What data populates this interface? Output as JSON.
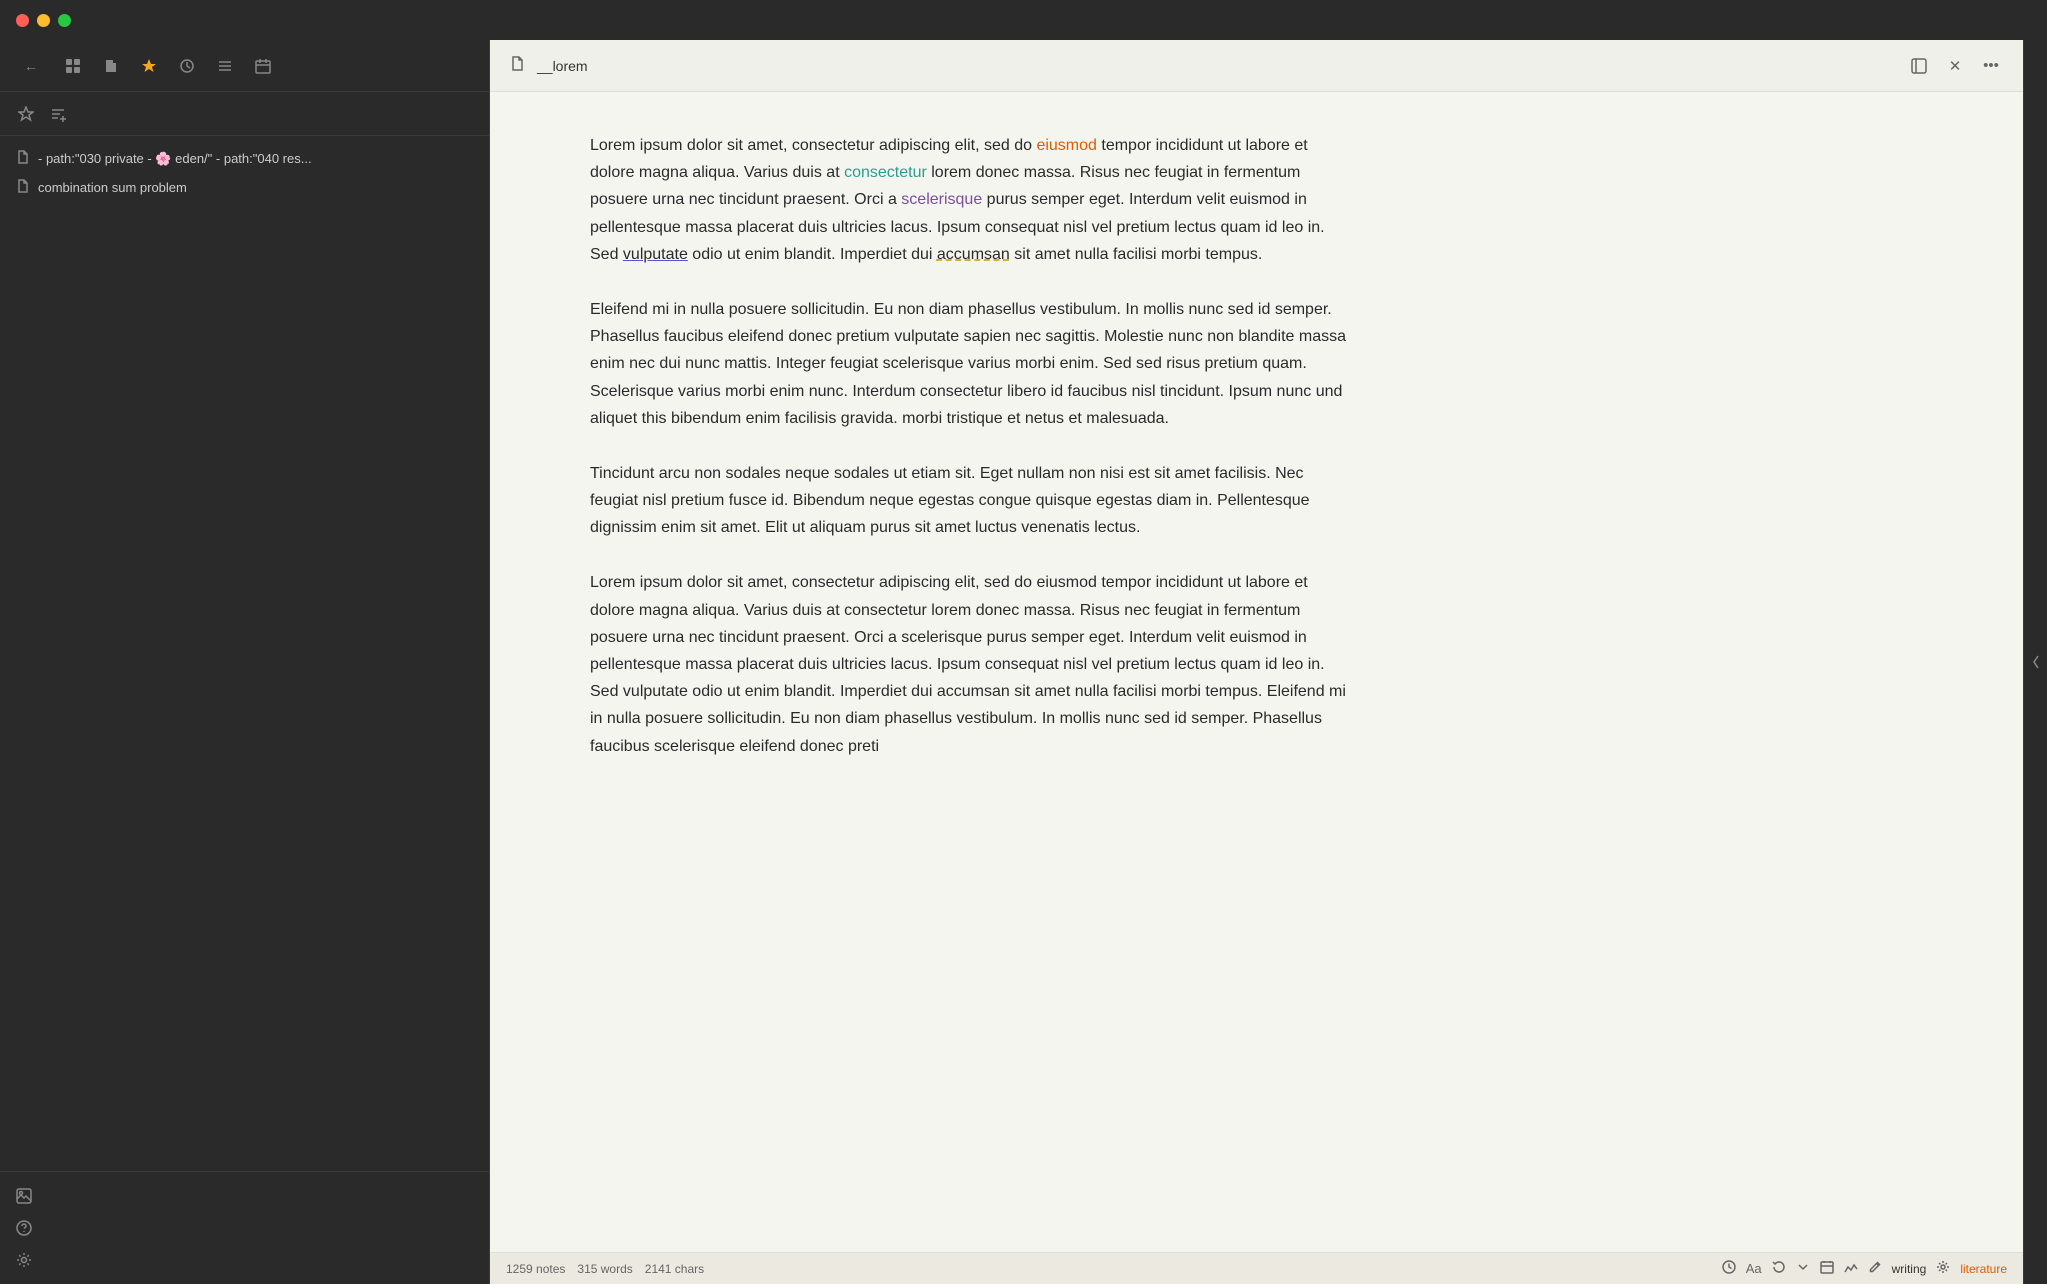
{
  "titlebar": {
    "traffic": [
      "red",
      "yellow",
      "green"
    ]
  },
  "sidebar": {
    "toolbar_icons": [
      {
        "name": "nav-back",
        "symbol": "←",
        "active": false
      },
      {
        "name": "grid-view",
        "symbol": "⊞",
        "active": false
      },
      {
        "name": "document-icon",
        "symbol": "📄",
        "active": false
      },
      {
        "name": "star-icon",
        "symbol": "★",
        "active": true
      },
      {
        "name": "clock-icon",
        "symbol": "🕐",
        "active": false
      },
      {
        "name": "list-icon",
        "symbol": "≡",
        "active": false
      },
      {
        "name": "calendar-icon",
        "symbol": "📅",
        "active": false
      }
    ],
    "nav_icons": [
      {
        "name": "star-nav",
        "symbol": "☆"
      },
      {
        "name": "list-add",
        "symbol": "≡+"
      }
    ],
    "items": [
      {
        "icon": "📄",
        "text": "- path:\"030 private - 🌸 eden/\" - path:\"040 res..."
      },
      {
        "icon": "📄",
        "text": "combination sum problem"
      }
    ],
    "bottom_icons": [
      {
        "name": "image-icon",
        "symbol": "🖼"
      },
      {
        "name": "help-icon",
        "symbol": "?"
      },
      {
        "name": "settings-icon",
        "symbol": "⚙"
      }
    ]
  },
  "document": {
    "icon": "📄",
    "title": "__lorem",
    "header_actions": [
      {
        "name": "sidebar-toggle",
        "symbol": "⬜"
      },
      {
        "name": "close",
        "symbol": "✕"
      },
      {
        "name": "more",
        "symbol": "•••"
      }
    ],
    "paragraphs": [
      {
        "id": "p1",
        "parts": [
          {
            "text": "Lorem ipsum dolor sit amet, consectetur adipiscing elit, sed do ",
            "style": "normal"
          },
          {
            "text": "eiusmod",
            "style": "highlight-orange"
          },
          {
            "text": " tempor incididunt ut labore et dolore magna aliqua. Varius duis at ",
            "style": "normal"
          },
          {
            "text": "consectetur",
            "style": "highlight-teal"
          },
          {
            "text": " lorem donec massa. Risus nec feugiat in fermentum posuere urna nec tincidunt praesent. Orci a ",
            "style": "normal"
          },
          {
            "text": "scelerisque",
            "style": "highlight-purple"
          },
          {
            "text": " purus semper eget. Interdum velit euismod in pellentesque massa placerat duis ultricies lacus. Ipsum consequat nisl vel pretium lectus quam id leo in. Sed ",
            "style": "normal"
          },
          {
            "text": "vulputate",
            "style": "underline-blue"
          },
          {
            "text": " odio ut enim blandit. Imperdiet dui ",
            "style": "normal"
          },
          {
            "text": "accumsan",
            "style": "underline-dashed"
          },
          {
            "text": " sit amet nulla facilisi morbi tempus.",
            "style": "normal"
          }
        ]
      },
      {
        "id": "p2",
        "text": "Eleifend mi in nulla posuere sollicitudin. Eu non diam phasellus vestibulum. In mollis nunc sed id semper. Phasellus faucibus eleifend donec pretium vulputate sapien nec sagittis. Molestie nunc non blandite massa enim nec dui nunc mattis. Integer feugiat scelerisque varius morbi enim. Sed sed risus pretium quam. Scelerisque varius morbi enim nunc. Interdum consectetur libero id faucibus nisl tincidunt. Ipsum nunc und aliquet this bibendum enim facilisis gravida. morbi tristique et netus et malesuada."
      },
      {
        "id": "p3",
        "text": "Tincidunt arcu non sodales neque sodales ut etiam sit. Eget nullam non nisi est sit amet facilisis. Nec feugiat nisl pretium fusce id. Bibendum neque egestas congue quisque egestas diam in. Pellentesque dignissim enim sit amet. Elit ut aliquam purus sit amet luctus venenatis lectus."
      },
      {
        "id": "p4",
        "text": "Lorem ipsum dolor sit amet, consectetur adipiscing elit, sed do eiusmod tempor incididunt ut labore et dolore magna aliqua. Varius duis at consectetur lorem donec massa. Risus nec feugiat in fermentum posuere urna nec tincidunt praesent. Orci a scelerisque purus semper eget. Interdum velit euismod in pellentesque massa placerat duis ultricies lacus. Ipsum consequat nisl vel pretium lectus quam id leo in. Sed vulputate odio ut enim blandit. Imperdiet dui accumsan sit amet nulla facilisi morbi tempus. Eleifend mi in nulla posuere sollicitudin. Eu non diam phasellus vestibulum. In mollis nunc sed id semper. Phasellus faucibus scelerisque eleifend donec preti"
      }
    ]
  },
  "statusbar": {
    "notes": "1259 notes",
    "words": "315 words",
    "chars": "2141 chars",
    "mode": "writing",
    "tag": "literature",
    "icons": [
      "clock",
      "Aa",
      "refresh",
      "down-arrow",
      "calendar",
      "graph",
      "pencil",
      "gear",
      "tag"
    ]
  }
}
